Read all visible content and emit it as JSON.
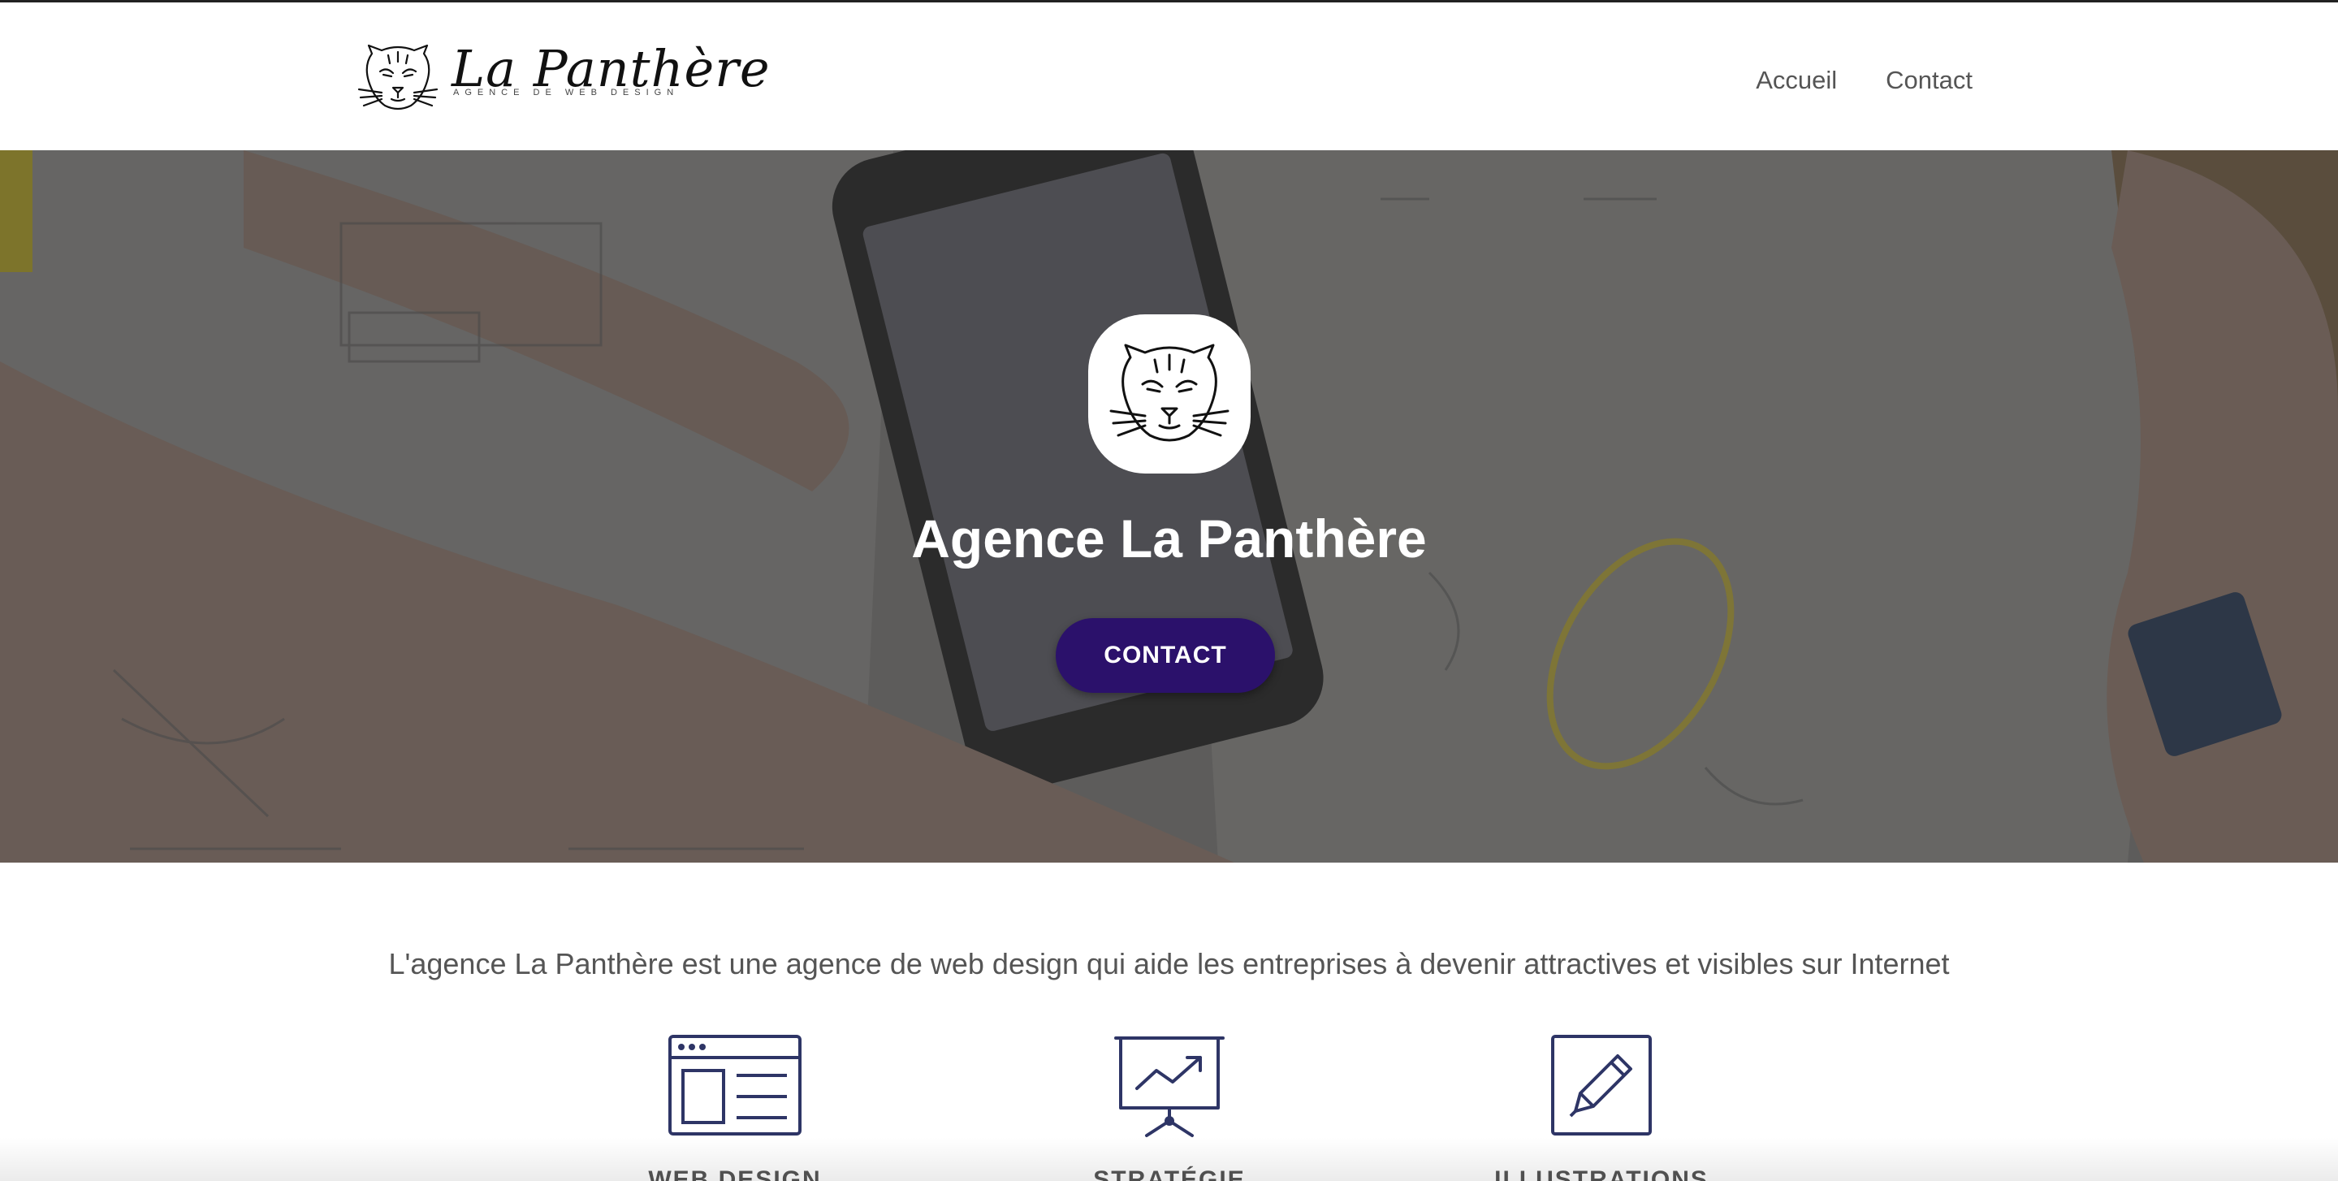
{
  "header": {
    "logo": {
      "title": "La Panthère",
      "tagline": "AGENCE DE WEB DESIGN",
      "icon": "panther-head-icon"
    },
    "nav": [
      {
        "label": "Accueil"
      },
      {
        "label": "Contact"
      }
    ]
  },
  "hero": {
    "title": "Agence La Panthère",
    "cta_label": "CONTACT",
    "background": "workspace-photo",
    "colors": {
      "cta_bg": "#2b116b",
      "title": "#ffffff"
    }
  },
  "intro": {
    "text": "L'agence La Panthère est une agence de web design qui aide les entreprises à devenir attractives et visibles sur Internet"
  },
  "services": [
    {
      "label": "WEB DESIGN",
      "icon": "browser-window-icon"
    },
    {
      "label": "STRATÉGIE",
      "icon": "presentation-chart-icon"
    },
    {
      "label": "ILLUSTRATIONS",
      "icon": "pencil-icon"
    }
  ],
  "colors": {
    "icon_stroke": "#2e3566",
    "text": "#555555"
  }
}
